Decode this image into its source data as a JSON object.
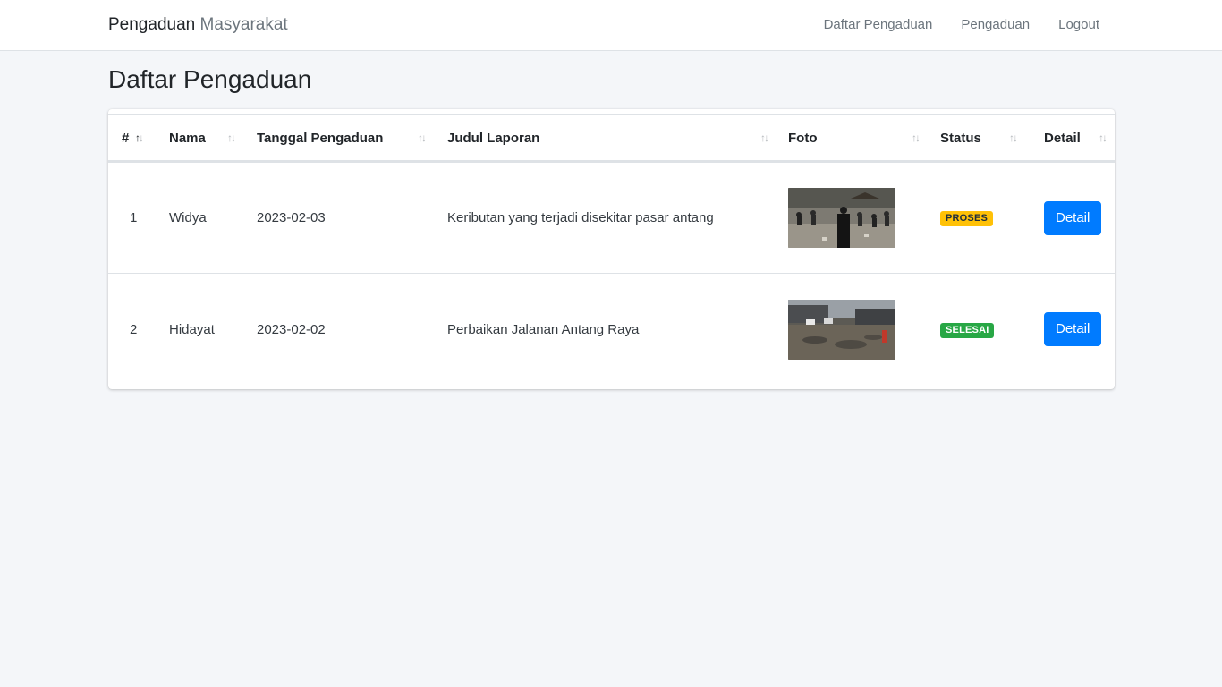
{
  "nav": {
    "brand_bold": "Pengaduan",
    "brand_light": "Masyarakat",
    "links": [
      "Daftar Pengaduan",
      "Pengaduan",
      "Logout"
    ]
  },
  "page": {
    "title": "Daftar Pengaduan"
  },
  "table": {
    "headers": [
      "#",
      "Nama",
      "Tanggal Pengaduan",
      "Judul Laporan",
      "Foto",
      "Status",
      "Detail"
    ],
    "rows": [
      {
        "no": "1",
        "nama": "Widya",
        "tanggal": "2023-02-03",
        "judul": "Keributan yang terjadi disekitar pasar antang",
        "status": "PROSES",
        "status_color": "#ffc107",
        "action": "Detail"
      },
      {
        "no": "2",
        "nama": "Hidayat",
        "tanggal": "2023-02-02",
        "judul": "Perbaikan Jalanan Antang Raya",
        "status": "SELESAI",
        "status_color": "#28a745",
        "action": "Detail"
      }
    ]
  },
  "colors": {
    "primary": "#007bff",
    "background": "#f4f6f9"
  }
}
